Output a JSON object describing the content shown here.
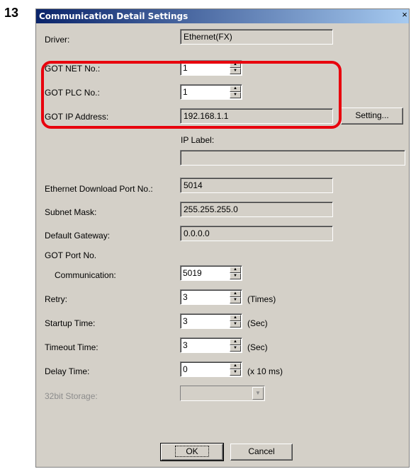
{
  "step_number": "13",
  "window": {
    "title": "Communication Detail Settings",
    "close_glyph": "×"
  },
  "fields": {
    "driver": {
      "label": "Driver:",
      "value": "Ethernet(FX)"
    },
    "got_net_no": {
      "label": "GOT NET No.:",
      "value": "1"
    },
    "got_plc_no": {
      "label": "GOT PLC No.:",
      "value": "1"
    },
    "got_ip_address": {
      "label": "GOT IP Address:",
      "value": "192.168.1.1"
    },
    "setting_button": "Setting...",
    "ip_label": {
      "label": "IP Label:",
      "value": ""
    },
    "ethernet_download_port": {
      "label": "Ethernet Download Port No.:",
      "value": "5014"
    },
    "subnet_mask": {
      "label": "Subnet Mask:",
      "value": "255.255.255.0"
    },
    "default_gateway": {
      "label": "Default Gateway:",
      "value": "0.0.0.0"
    },
    "got_port_heading": "GOT Port No.",
    "communication": {
      "label": "Communication:",
      "value": "5019"
    },
    "retry": {
      "label": "Retry:",
      "value": "3",
      "unit": "(Times)"
    },
    "startup_time": {
      "label": "Startup Time:",
      "value": "3",
      "unit": "(Sec)"
    },
    "timeout_time": {
      "label": "Timeout Time:",
      "value": "3",
      "unit": "(Sec)"
    },
    "delay_time": {
      "label": "Delay Time:",
      "value": "0",
      "unit": "(x 10 ms)"
    },
    "storage_32bit": {
      "label": "32bit Storage:",
      "value": ""
    }
  },
  "buttons": {
    "ok": "OK",
    "cancel": "Cancel"
  },
  "icons": {
    "spin_up": "up-arrow-icon",
    "spin_down": "down-arrow-icon",
    "combo": "chevron-down-icon"
  },
  "colors": {
    "highlight": "#e8000d",
    "titlebar": "#0a246a",
    "dialog_bg": "#d4d0c8"
  }
}
